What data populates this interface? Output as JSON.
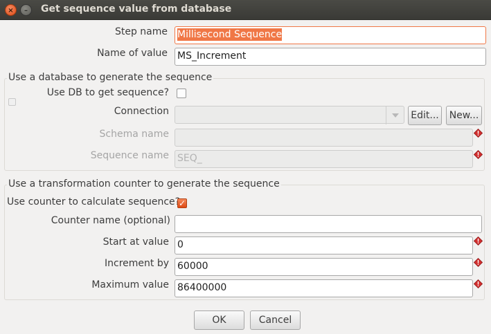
{
  "window": {
    "title": "Get sequence value from database",
    "close_glyph": "×",
    "minimize_glyph": "–"
  },
  "fields": {
    "step_name_label": "Step name",
    "step_name_value": "Millisecond Sequence",
    "name_of_value_label": "Name of value",
    "name_of_value_value": "MS_Increment"
  },
  "db_group": {
    "title": "Use a database to generate the sequence",
    "use_db_label": "Use DB to get sequence?",
    "use_db_checked": false,
    "connection_label": "Connection",
    "connection_value": "",
    "edit_button": "Edit...",
    "new_button": "New...",
    "schema_label": "Schema name",
    "schema_value": "",
    "sequence_label": "Sequence name",
    "sequence_value": "SEQ_"
  },
  "counter_group": {
    "title": "Use a transformation counter to generate the sequence",
    "use_counter_label": "Use counter to calculate sequence?",
    "use_counter_checked": true,
    "check_glyph": "✓",
    "counter_name_label": "Counter name (optional)",
    "counter_name_value": "",
    "start_label": "Start at value",
    "start_value": "0",
    "increment_label": "Increment by",
    "increment_value": "60000",
    "max_label": "Maximum value",
    "max_value": "86400000"
  },
  "buttons": {
    "ok": "OK",
    "cancel": "Cancel"
  },
  "colors": {
    "accent": "#f07746",
    "warning": "#c62828"
  }
}
